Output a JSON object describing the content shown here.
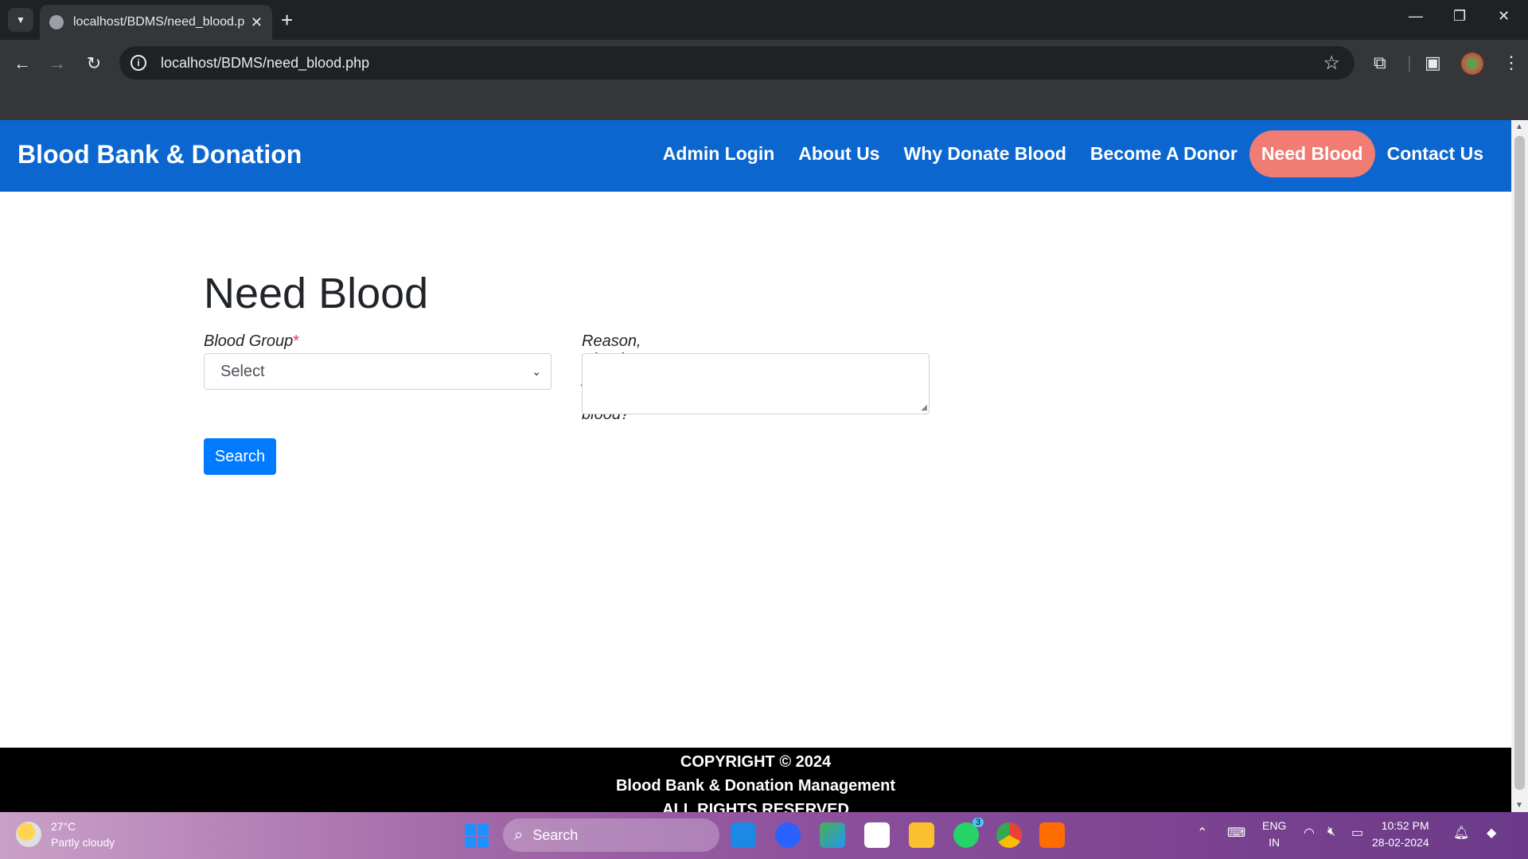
{
  "browser": {
    "tab_title": "localhost/BDMS/need_blood.ph",
    "url": "localhost/BDMS/need_blood.php"
  },
  "site": {
    "brand": "Blood Bank & Donation",
    "nav": [
      {
        "label": "Admin Login",
        "active": false
      },
      {
        "label": "About Us",
        "active": false
      },
      {
        "label": "Why Donate Blood",
        "active": false
      },
      {
        "label": "Become A Donor",
        "active": false
      },
      {
        "label": "Need Blood",
        "active": true
      },
      {
        "label": "Contact Us",
        "active": false
      }
    ]
  },
  "form": {
    "heading": "Need Blood",
    "blood_group_label": "Blood Group",
    "blood_group_value": "Select",
    "reason_label": "Reason, why do you need blood?",
    "required_mark": "*",
    "reason_value": "",
    "submit_label": "Search"
  },
  "footer": {
    "line1": "COPYRIGHT © 2024",
    "line2": "Blood Bank & Donation Management",
    "line3": "ALL RIGHTS RESERVED"
  },
  "taskbar": {
    "temperature": "27°C",
    "weather": "Partly cloudy",
    "search_label": "Search",
    "lang1": "ENG",
    "lang2": "IN",
    "time": "10:52 PM",
    "date": "28-02-2024",
    "whatsapp_badge": "3"
  },
  "colors": {
    "navbar": "#0b67cf",
    "active_nav": "#f07c73",
    "primary_button": "#007bff",
    "footer": "#000000"
  }
}
